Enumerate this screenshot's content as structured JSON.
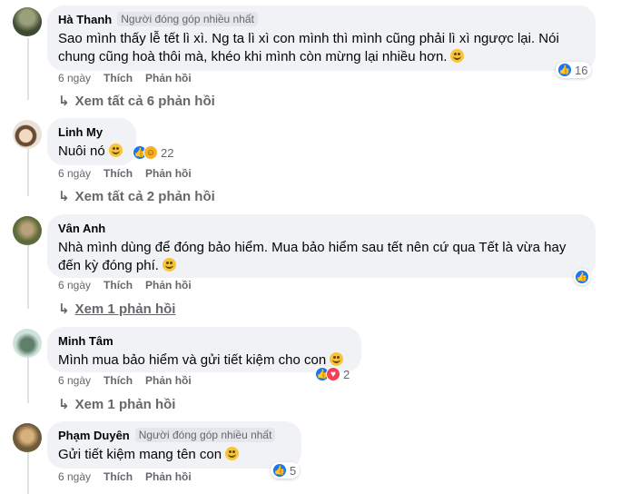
{
  "comments": [
    {
      "author": "Hà Thanh",
      "badge": "Người đóng góp nhiều nhất",
      "text": "Sao mình thấy lễ tết lì xì. Ng ta lì xì con mình thì mình cũng phải lì xì ngược lại. Nói chung cũng hoà thôi mà, khéo khi mình còn mừng lại nhiều hơn.",
      "time": "6 ngày",
      "like": "Thích",
      "reply": "Phản hồi",
      "view_replies": "Xem tất cả 6 phản hồi",
      "reaction_count": "16",
      "avatar_color": "#4a5a3c"
    },
    {
      "author": "Linh My",
      "text": "Nuôi nó",
      "time": "6 ngày",
      "like": "Thích",
      "reply": "Phản hồi",
      "view_replies": "Xem tất cả 2 phản hồi",
      "reaction_count": "22",
      "avatar_color": "#d8c9b4"
    },
    {
      "author": "Vân Anh",
      "text": "Nhà mình dùng để đóng bảo hiểm. Mua bảo hiểm sau tết nên cứ qua Tết là vừa hay đến kỳ đóng phí.",
      "time": "6 ngày",
      "like": "Thích",
      "reply": "Phản hồi",
      "view_replies": "Xem 1 phản hồi",
      "avatar_color": "#7a8a5a"
    },
    {
      "author": "Minh Tâm",
      "text": "Mình mua bảo hiểm và gửi tiết kiệm cho con",
      "time": "6 ngày",
      "like": "Thích",
      "reply": "Phản hồi",
      "view_replies": "Xem 1 phản hồi",
      "reaction_count": "2",
      "avatar_color": "#8fb8a8"
    },
    {
      "author": "Phạm Duyên",
      "badge": "Người đóng góp nhiều nhất",
      "text": "Gửi tiết kiệm mang tên con",
      "time": "6 ngày",
      "like": "Thích",
      "reply": "Phản hồi",
      "reaction_count": "5",
      "avatar_color": "#b08a5a"
    }
  ]
}
